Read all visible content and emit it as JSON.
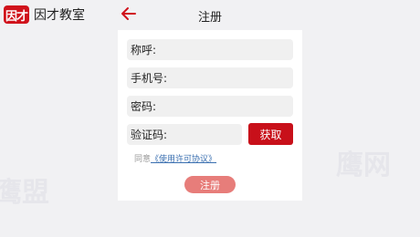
{
  "header": {
    "logo_text": "因才",
    "brand_name": "因才教室",
    "back_icon": "arrow-left-icon",
    "title": "注册"
  },
  "form": {
    "name_label": "称呼:",
    "phone_label": "手机号:",
    "password_label": "密码:",
    "code_label": "验证码:",
    "get_code_label": "获取",
    "agreement_prefix": "同意",
    "agreement_link": "《使用许可协议》",
    "register_label": "注册"
  },
  "watermarks": [
    "鹰盟",
    "鹰网"
  ],
  "colors": {
    "brand_red": "#d0121b",
    "get_code_bg": "#c8101a",
    "register_bg": "#e77d7a",
    "link": "#3a6fb0",
    "page_bg": "#f1f1f3"
  }
}
